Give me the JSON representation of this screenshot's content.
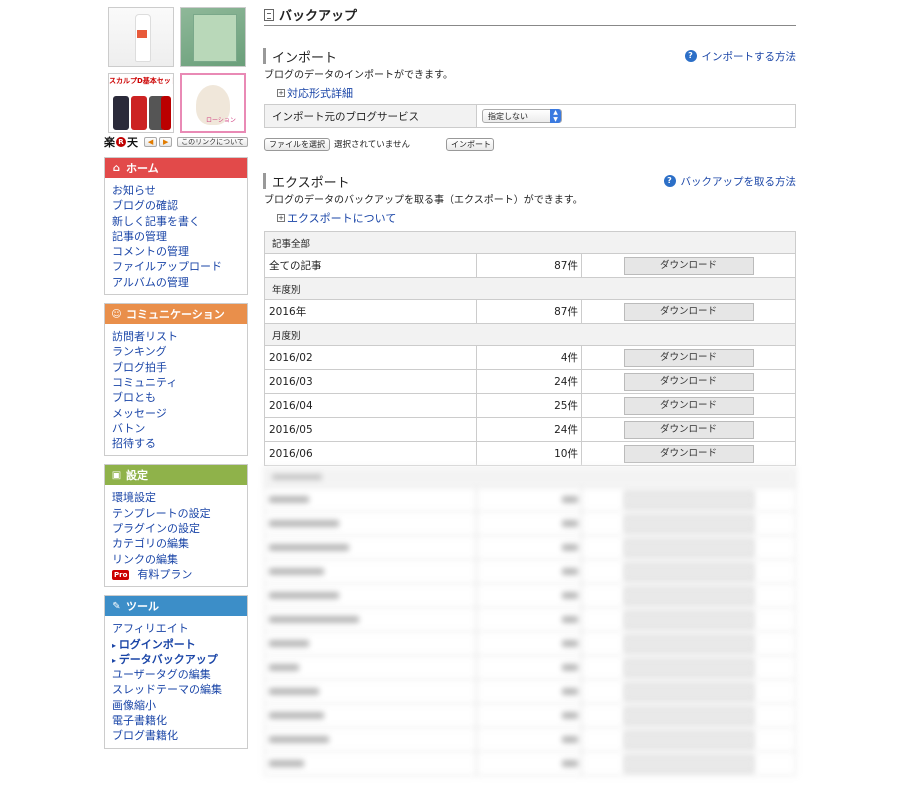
{
  "ads": {
    "scalp_text": "スカルプD基本セット",
    "lotion_text": "ローション"
  },
  "rakuten": {
    "logo_left": "楽",
    "logo_dot": "R",
    "logo_right": "天",
    "prev": "◀",
    "next": "▶",
    "link_label": "このリンクについて"
  },
  "sidebar": {
    "home": {
      "title": "ホーム",
      "items": [
        "お知らせ",
        "ブログの確認",
        "新しく記事を書く",
        "記事の管理",
        "コメントの管理",
        "ファイルアップロード",
        "アルバムの管理"
      ]
    },
    "communication": {
      "title": "コミュニケーション",
      "items": [
        "訪問者リスト",
        "ランキング",
        "ブログ拍手",
        "コミュニティ",
        "ブロとも",
        "メッセージ",
        "バトン",
        "招待する"
      ]
    },
    "settings": {
      "title": "設定",
      "items": [
        "環境設定",
        "テンプレートの設定",
        "プラグインの設定",
        "カテゴリの編集",
        "リンクの編集"
      ],
      "pro_badge": "Pro",
      "pro_item": "有料プラン"
    },
    "tools": {
      "title": "ツール",
      "items": [
        "アフィリエイト",
        "ログインポート",
        "データバックアップ",
        "ユーザータグの編集",
        "スレッドテーマの編集",
        "画像縮小",
        "電子書籍化",
        "ブログ書籍化"
      ],
      "active": [
        "ログインポート",
        "データバックアップ"
      ]
    }
  },
  "main": {
    "title": "バックアップ",
    "import": {
      "heading": "インポート",
      "help": "インポートする方法",
      "desc": "ブログのデータのインポートができます。",
      "formats_link": "対応形式詳細",
      "service_label": "インポート元のブログサービス",
      "service_value": "指定しない",
      "file_button": "ファイルを選択",
      "file_status": "選択されていません",
      "import_button": "インポート"
    },
    "export": {
      "heading": "エクスポート",
      "help": "バックアップを取る方法",
      "desc": "ブログのデータのバックアップを取る事（エクスポート）ができます。",
      "about_link": "エクスポートについて",
      "download_label": "ダウンロード",
      "groups": [
        {
          "title": "記事全部",
          "rows": [
            {
              "label": "全ての記事",
              "count": "87件"
            }
          ]
        },
        {
          "title": "年度別",
          "rows": [
            {
              "label": "2016年",
              "count": "87件"
            }
          ]
        },
        {
          "title": "月度別",
          "rows": [
            {
              "label": "2016/02",
              "count": "4件"
            },
            {
              "label": "2016/03",
              "count": "24件"
            },
            {
              "label": "2016/04",
              "count": "25件"
            },
            {
              "label": "2016/05",
              "count": "24件"
            },
            {
              "label": "2016/06",
              "count": "10件"
            }
          ]
        }
      ]
    }
  }
}
